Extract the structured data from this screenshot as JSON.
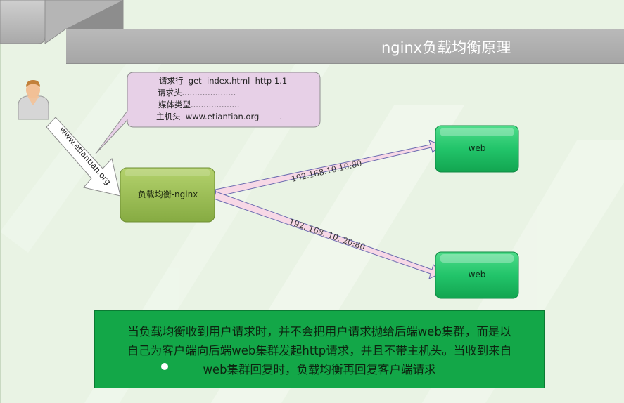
{
  "title": "nginx负载均衡原理",
  "client": {
    "url_label": "www.etiantian.org"
  },
  "request_bubble": {
    "lines": [
      "请求行  get  index.html  http 1.1",
      "请求头.....................",
      "媒体类型...................",
      "主机头  www.etiantian.org        ."
    ]
  },
  "load_balancer": {
    "label": "负载均衡-nginx"
  },
  "servers": [
    {
      "label": "web",
      "address": "192.168.10.10:80"
    },
    {
      "label": "web",
      "address": "192. 168. 10. 20:80"
    }
  ],
  "note": {
    "lines": [
      "当负载均衡收到用户请求时，并不会把用户请求抛给后端web集群，而是以",
      "自己为客户端向后端web集群发起http请求，并且不带主机头。当收到来自",
      "web集群回复时，负载均衡再回复客户端请求"
    ]
  },
  "colors": {
    "background": "#e9f3e4",
    "title_bar": "#a6a6a6",
    "bubble": "#e7d0e7",
    "load_balancer": "#8db04a",
    "web_server": "#1fbf66",
    "note_box": "#13a748",
    "arrow": "#f7d8e6"
  },
  "icons": [
    "user-icon"
  ]
}
